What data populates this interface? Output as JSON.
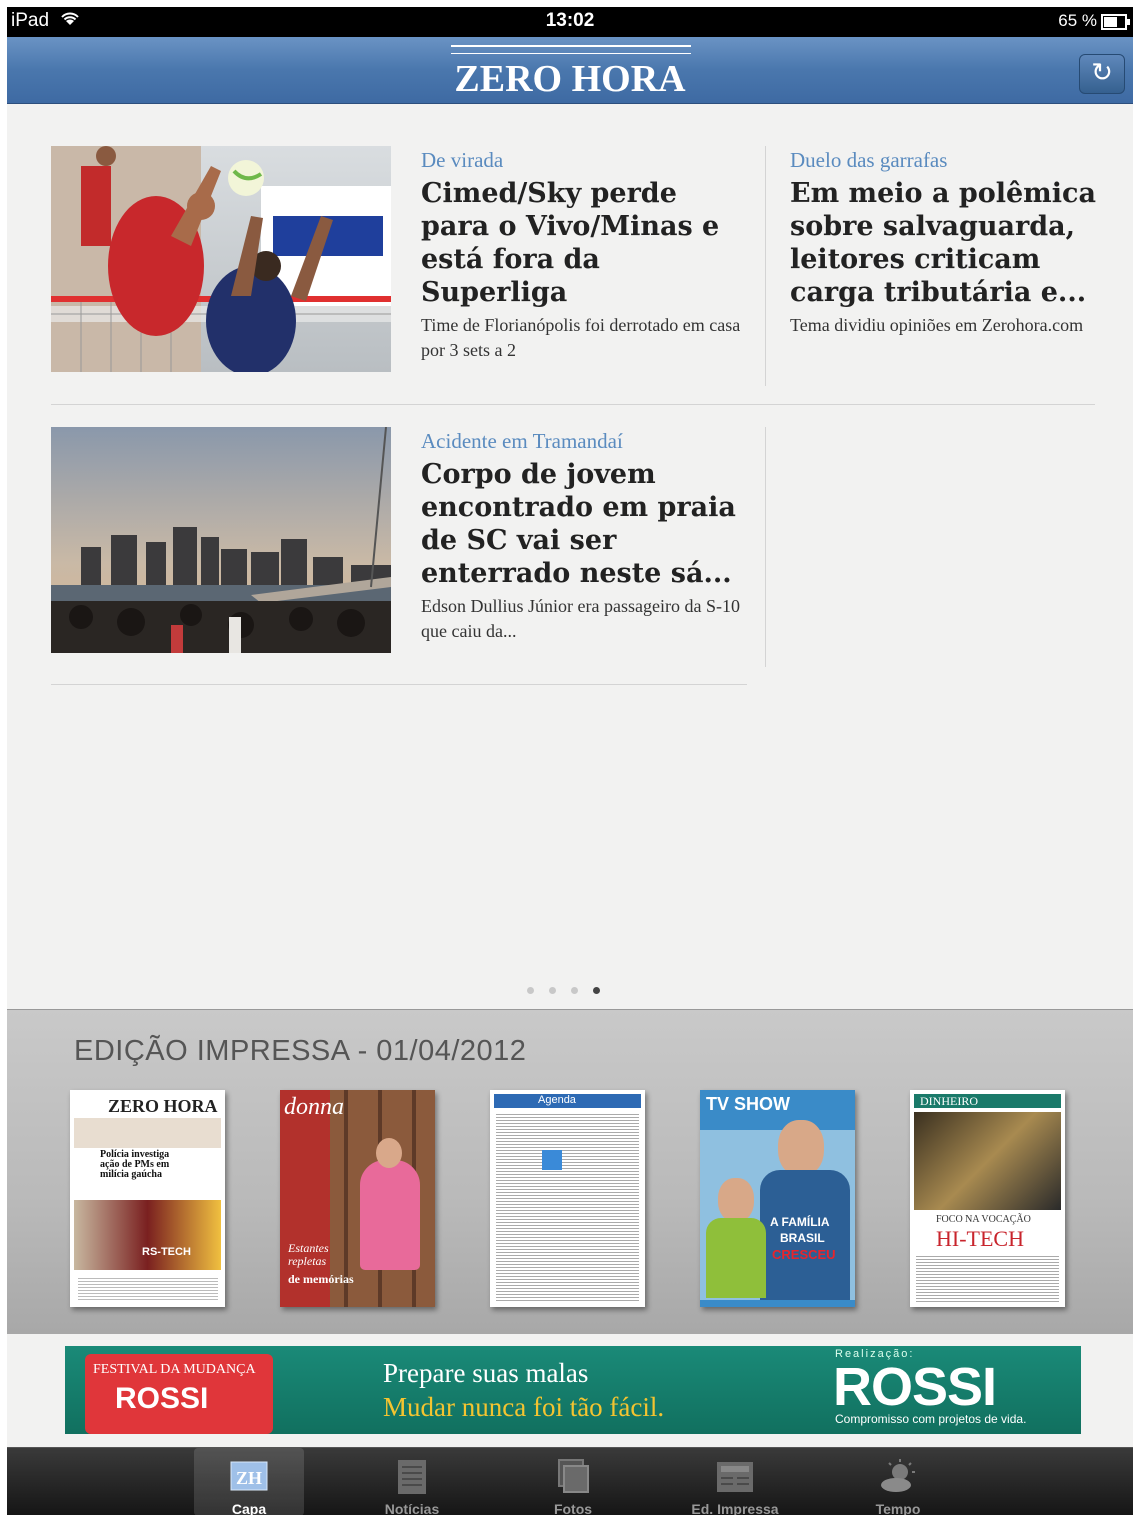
{
  "status_bar": {
    "device": "iPad",
    "time": "13:02",
    "battery": "65 %"
  },
  "header": {
    "logo": "ZERO HORA",
    "refresh_icon": "refresh-icon"
  },
  "articles": [
    {
      "kicker": "De virada",
      "headline": "Cimed/Sky perde para o Vivo/Minas e está fora da Superliga",
      "summary": "Time de Florianópolis foi derrotado em casa por 3 sets a 2"
    },
    {
      "kicker": "Duelo das garrafas",
      "headline": "Em meio a polêmica sobre salvaguarda, leitores criticam carga tributária e...",
      "summary": "Tema dividiu opiniões em Zerohora.com"
    },
    {
      "kicker": "Acidente em Tramandaí",
      "headline": "Corpo de jovem encontrado em praia de SC vai ser enterrado neste sá...",
      "summary": "Edson Dullius Júnior era passageiro da S-10 que caiu da..."
    }
  ],
  "pager": {
    "pages": 4,
    "active": 4
  },
  "print_edition": {
    "title": "EDIÇÃO IMPRESSA - 01/04/2012",
    "covers": [
      {
        "masthead": "ZERO HORA",
        "text1": "Polícia investiga ação de PMs em milícia gaúcha",
        "text2": "RS-TECH"
      },
      {
        "masthead": "donna",
        "text1": "Estantes repletas",
        "text2": "de memórias"
      },
      {
        "masthead": "Agenda"
      },
      {
        "masthead": "TV SHOW",
        "text1": "A FAMÍLIA",
        "text2": "BRASIL",
        "text3": "CRESCEU"
      },
      {
        "masthead": "DINHEIRO",
        "text1": "FOCO NA VOCAÇÃO",
        "text2": "HI-TECH"
      }
    ]
  },
  "ad": {
    "left_top": "FESTIVAL DA MUDANÇA",
    "left_brand": "ROSSI",
    "line1": "Prepare suas malas",
    "line2": "Mudar nunca foi tão fácil.",
    "realizacao": "Realização:",
    "brand": "ROSSI",
    "slogan": "Compromisso com projetos de vida."
  },
  "tabs": [
    {
      "label": "Capa",
      "icon": "zh-logo-icon"
    },
    {
      "label": "Notícias",
      "icon": "newspaper-icon"
    },
    {
      "label": "Fotos",
      "icon": "photos-icon"
    },
    {
      "label": "Ed. Impressa",
      "icon": "print-edition-icon"
    },
    {
      "label": "Tempo",
      "icon": "weather-icon"
    }
  ]
}
